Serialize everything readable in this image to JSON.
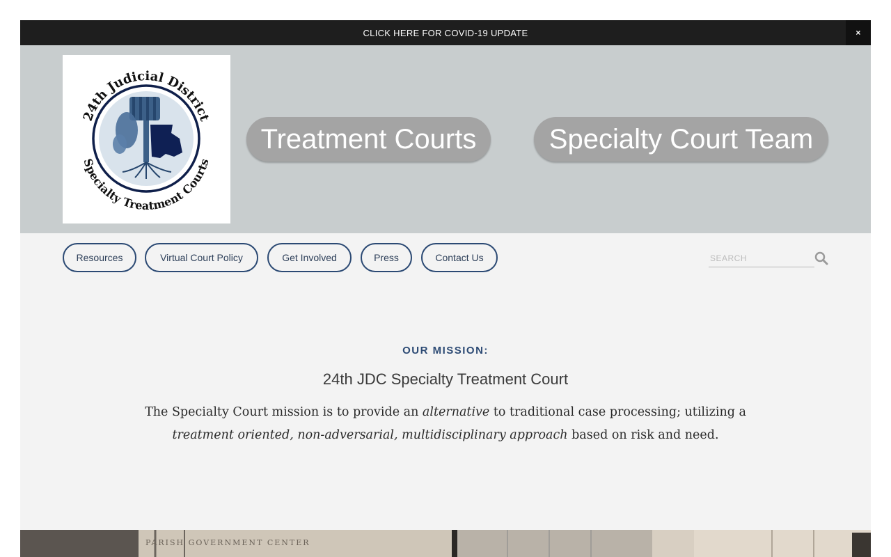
{
  "announcement": {
    "text": "CLICK HERE FOR COVID-19 UPDATE",
    "close": "×"
  },
  "logo": {
    "top_text": "24th Judicial District",
    "bottom_text": "Specialty Treatment Courts"
  },
  "header": {
    "buttons": [
      {
        "label": "Treatment Courts"
      },
      {
        "label": "Specialty Court Team"
      }
    ]
  },
  "nav": {
    "items": [
      {
        "label": "Resources"
      },
      {
        "label": "Virtual Court Policy"
      },
      {
        "label": "Get Involved"
      },
      {
        "label": "Press"
      },
      {
        "label": "Contact Us"
      }
    ]
  },
  "search": {
    "placeholder": "SEARCH",
    "value": ""
  },
  "mission": {
    "label": "OUR MISSION:",
    "title": "24th JDC Specialty Treatment Court",
    "text_1": "The Specialty Court mission is to provide an ",
    "text_2_italic": "alternative",
    "text_3": " to traditional case processing; utilizing a ",
    "text_4_italic": "treatment oriented, non-adversarial, multidisciplinary approach",
    "text_5": " based on risk and need."
  },
  "photo": {
    "sign_text": "PARISH GOVERNMENT CENTER"
  },
  "colors": {
    "header_bg": "#c8cdce",
    "nav_border": "#2c4a74",
    "pill_bg": "#a4a4a4",
    "announce_bg": "#1e1e1e",
    "main_bg": "#f3f3f3"
  }
}
